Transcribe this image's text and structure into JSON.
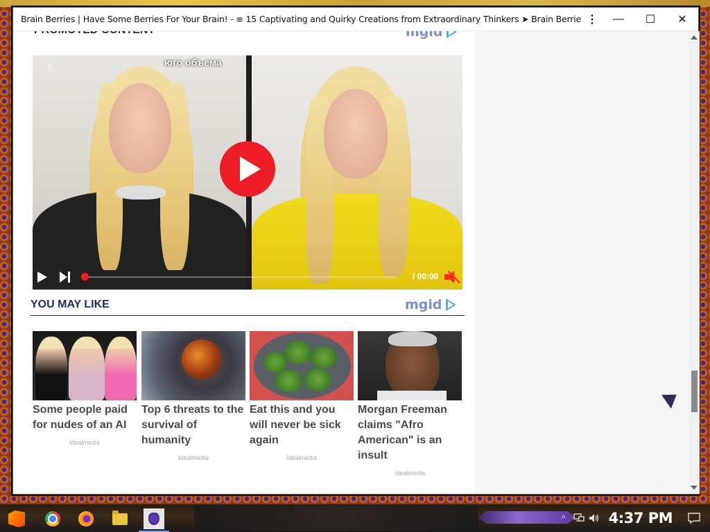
{
  "window": {
    "title": "Brain Berries | Have Some Berries For Your Brain! - ≡ 15 Captivating and Quirky Creations from Extraordinary Thinkers ➤ Brain Berries",
    "minimize_glyph": "—",
    "maximize_glyph": "☐",
    "close_glyph": "✕",
    "menu_glyph": "⋮"
  },
  "promoted": {
    "title": "PROMOTED CONTENT",
    "logo": "mgid"
  },
  "video": {
    "overlay_text": "юго объема",
    "overlay_text_small": "Б",
    "time": "/ 00:00",
    "muted": true
  },
  "you_may_like": {
    "title": "YOU MAY LIKE",
    "logo": "mgid",
    "cards": [
      {
        "title": "Some people paid for nudes of an AI",
        "source": "Idealmedia"
      },
      {
        "title": "Top 6 threats to the survival of humanity",
        "source": "Idealmedia"
      },
      {
        "title": "Eat this and you will never be sick again",
        "source": "Idealmedia"
      },
      {
        "title": "Morgan Freeman claims \"Afro American\" is an insult",
        "source": "Idealmedia"
      }
    ]
  },
  "taskbar": {
    "apps": [
      "start-icon",
      "chrome-icon",
      "firefox-icon",
      "file-explorer-icon",
      "grape-app-icon"
    ],
    "tray": {
      "chevron": "^",
      "clock": "4:37 PM"
    }
  },
  "colors": {
    "accent_blue": "#1e2a6a",
    "play_red": "#ee1c24",
    "card_text": "#4a4a4a"
  }
}
